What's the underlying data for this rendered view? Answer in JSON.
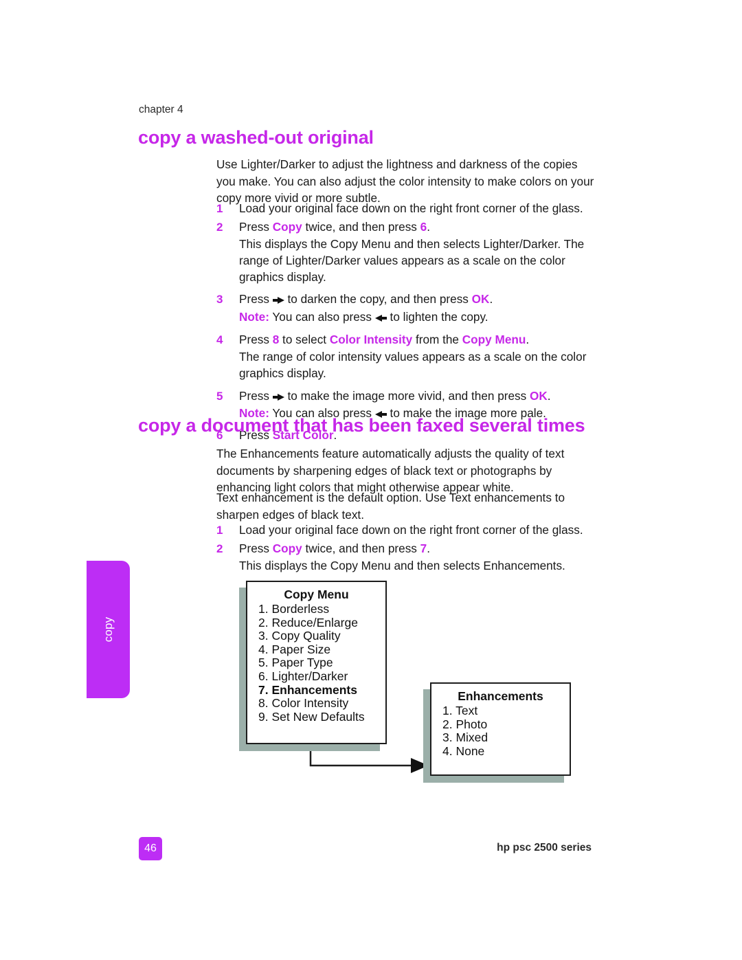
{
  "page": {
    "chapter_label": "chapter 4",
    "page_number": "46",
    "footer_right": "hp psc 2500 series",
    "side_tab_label": "copy",
    "accent_color": "#c627e8",
    "tab_color": "#bd2df5",
    "shadow_color": "#9bafa9"
  },
  "section1": {
    "heading": "copy a washed-out original",
    "intro": "Use Lighter/Darker to adjust the lightness and darkness of the copies you make. You can also adjust the color intensity to make colors on your copy more vivid or more subtle.",
    "steps": [
      {
        "num": "1",
        "text": "Load your original face down on the right front corner of the glass."
      },
      {
        "num": "2",
        "text": "Press Copy twice, and then press 6."
      },
      {
        "num": "3",
        "text": "Press ▶ to darken the copy, and then press OK."
      },
      {
        "num": "4",
        "text": "Press 8 to select Color Intensity from the Copy Menu."
      },
      {
        "num": "5",
        "text": "Press ▶ to make the image more vivid, and then press OK."
      },
      {
        "num": "6",
        "text": "Press Start Color."
      }
    ],
    "step2_detail": "This displays the Copy Menu and then selects Lighter/Darker. The range of Lighter/Darker values appears as a scale on the color graphics display.",
    "note3_label": "Note:",
    "note3_text": "You can also press ◀ to lighten the copy.",
    "step4_detail": "The range of color intensity values appears as a scale on the color graphics display.",
    "note5_label": "Note:",
    "note5_text": "You can also press ◀ to make the image more pale.",
    "inline": {
      "copy": "Copy",
      "six": "6",
      "ok": "OK",
      "eight": "8",
      "color_intensity": "Color Intensity",
      "copy_menu": "Copy Menu",
      "start_color": "Start Color"
    }
  },
  "section2": {
    "heading": "copy a document that has been faxed several times",
    "para1": "The Enhancements feature automatically adjusts the quality of text documents by sharpening edges of black text or photographs by enhancing light colors that might otherwise appear white.",
    "para2": "Text enhancement is the default option. Use Text enhancements to sharpen edges of black text.",
    "steps": [
      {
        "num": "1",
        "text": "Load your original face down on the right front corner of the glass."
      },
      {
        "num": "2",
        "text": "Press Copy twice, and then press 7."
      }
    ],
    "step2_detail": "This displays the Copy Menu and then selects Enhancements.",
    "inline": {
      "copy": "Copy",
      "seven": "7"
    }
  },
  "diagram": {
    "copy_menu": {
      "title": "Copy Menu",
      "items": [
        "1. Borderless",
        "2. Reduce/Enlarge",
        "3. Copy Quality",
        "4. Paper Size",
        "5. Paper Type",
        "6. Lighter/Darker",
        "7. Enhancements",
        "8. Color Intensity",
        "9. Set New Defaults"
      ],
      "highlighted_index": 6
    },
    "enhancements": {
      "title": "Enhancements",
      "items": [
        "1. Text",
        "2. Photo",
        "3. Mixed",
        "4. None"
      ]
    }
  }
}
